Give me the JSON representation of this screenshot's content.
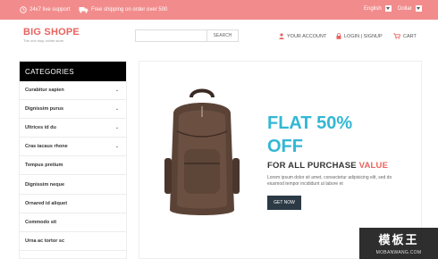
{
  "topbar": {
    "support": "24x7 live support",
    "shipping": "Free shipping on order over 500",
    "language": "English",
    "currency": "Dollar"
  },
  "header": {
    "logo_primary": "BIG SHOPE",
    "tagline": "The one stop online store",
    "search_placeholder": "",
    "search_button": "SEARCH",
    "account": "YOUR ACCOUNT",
    "login": "LOGIN | SIGNUP",
    "cart": "CART"
  },
  "sidebar": {
    "title": "CATEGORIES",
    "items": [
      {
        "label": "Curabitur sapien"
      },
      {
        "label": "Dignissim purus"
      },
      {
        "label": "Ultrices id du"
      },
      {
        "label": "Cras iacaus rhone"
      },
      {
        "label": "Tempus pretium"
      },
      {
        "label": "Dignissim neque"
      },
      {
        "label": "Ornared id aliquet"
      },
      {
        "label": "Commodo sit"
      },
      {
        "label": "Urna ac tortor sc"
      }
    ]
  },
  "banner": {
    "headline_1": "FLAT 50%",
    "headline_2": "OFF",
    "subheadline_pre": "FOR ALL PURCHASE",
    "subheadline_accent": "VALUE",
    "body": "Lorem ipsum dolor sit amet, consectetur adipisicing elit, sed do eiusmod tempor incididunt ut labore et",
    "button": "GET NOW"
  },
  "watermark": {
    "cn": "模板王",
    "url": "MOBANWANG.COM"
  },
  "colors": {
    "topbar": "#f28c8c",
    "brand": "#e8635f",
    "accent_blue": "#33b7d4",
    "button_dark": "#2b3a45"
  }
}
